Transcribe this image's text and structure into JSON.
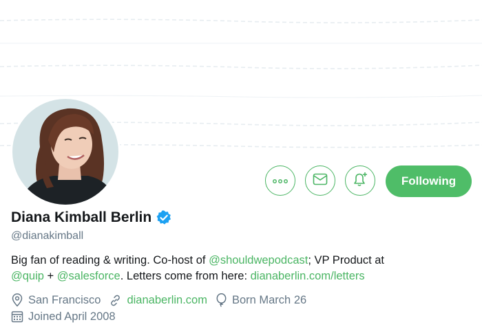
{
  "profile": {
    "name": "Diana Kimball Berlin",
    "handle": "@dianakimball",
    "follow_label": "Following"
  },
  "bio": {
    "part1": "Big fan of reading & writing. Co-host of ",
    "mention1": "@shouldwepodcast",
    "part2": "; VP Product at ",
    "mention2": "@quip",
    "part3": " + ",
    "mention3": "@salesforce",
    "part4": ". Letters come from here: ",
    "link": "dianaberlin.com/letters"
  },
  "meta": {
    "location": "San Francisco",
    "website": "dianaberlin.com",
    "birthday": "Born March 26",
    "joined": "Joined April 2008"
  },
  "icons": {
    "more": "more-icon",
    "message": "mail-icon",
    "notifications": "bell-plus-icon",
    "verified": "verified-badge-icon",
    "location": "location-pin-icon",
    "link": "link-icon",
    "birthday": "balloon-icon",
    "calendar": "calendar-icon"
  },
  "colors": {
    "accent": "#4ab563",
    "follow_button": "#4fbd68",
    "verified": "#1da1f2",
    "secondary_text": "#657786"
  }
}
